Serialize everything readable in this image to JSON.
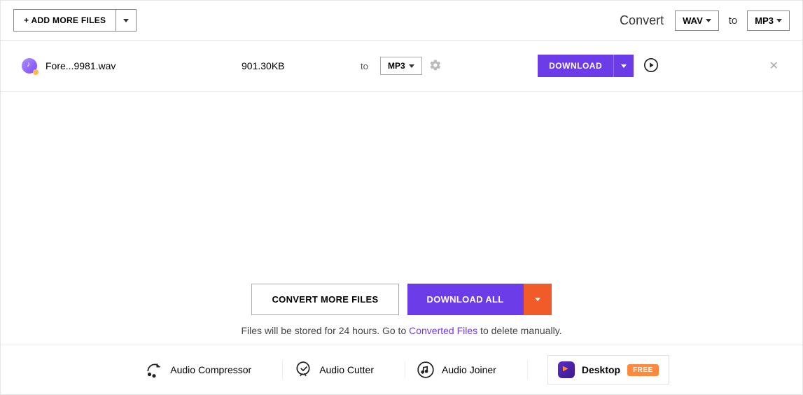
{
  "toolbar": {
    "add_label": "+ ADD MORE FILES",
    "convert_label": "Convert",
    "source_format": "WAV",
    "to_label": "to",
    "target_format": "MP3"
  },
  "file": {
    "name": "Fore...9981.wav",
    "size": "901.30KB",
    "to_label": "to",
    "target_format": "MP3",
    "download_label": "DOWNLOAD"
  },
  "actions": {
    "convert_more": "CONVERT MORE FILES",
    "download_all": "DOWNLOAD ALL"
  },
  "storage": {
    "prefix": "Files will be stored for 24 hours. Go to ",
    "link": "Converted Files",
    "suffix": " to delete manually."
  },
  "footer": {
    "compressor": "Audio Compressor",
    "cutter": "Audio Cutter",
    "joiner": "Audio Joiner",
    "desktop": "Desktop",
    "free": "FREE"
  }
}
